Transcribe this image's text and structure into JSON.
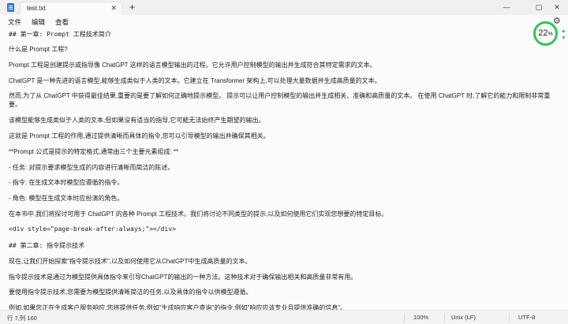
{
  "tab": {
    "title": "test.txt",
    "close": "✕",
    "new": "+"
  },
  "window": {
    "minimize": "—",
    "maximize": "▢",
    "close": "✕"
  },
  "menu": {
    "file": "文件",
    "edit": "编辑",
    "view": "查看"
  },
  "zoom": {
    "value": "22",
    "unit": "%"
  },
  "lines": [
    "## 第一章: Prompt 工程技术简介",
    "什么是 Prompt 工程?",
    "Prompt 工程是创建提示或指导像 ChatGPT 这样的语言模型输出的过程。它允许用户控制模型的输出并生成符合其特定需求的文本。",
    "ChatGPT 是一种先进的语言模型,能够生成类似于人类的文本。它建立在 Transformer 架构上,可以处理大量数据并生成高质量的文本。",
    "然而,为了从 ChatGPT 中获得最佳结果,重要的是要了解如何正确地提示模型。 提示可以让用户控制模型的输出并生成相关、准确和高质量的文本。 在使用 ChatGPT 时,了解它的能力和限制非常重",
    "要。",
    "该模型能够生成类似于人类的文本,但如果没有适当的指导,它可能无法始终产生期望的输出。",
    "这就是 Prompt 工程的作用,通过提供清晰而具体的指令,您可以引导模型的输出并确保其相关。",
    "**Prompt 公式是提示的特定格式,通常由三个主要元素组成: **",
    "- 任务: 对提示要求模型生成的内容进行清晰而简洁的陈述。",
    "- 指令: 在生成文本时模型应遵循的指令。",
    "- 角色: 模型在生成文本时应扮演的角色。",
    "在本书中,我们将探讨可用于 ChatGPT 的各种 Prompt 工程技术。我们将讨论不同类型的提示,以及如何使用它们实现您想要的特定目标。",
    "<div style=\"page-break-after:always;\"></div>",
    "## 第二章: 指令提示技术",
    "现在,让我们开始探索\"指令提示技术\",以及如何使用它从ChatGPT中生成高质量的文本。",
    "指令提示技术是通过为模型提供具体指令来引导ChatGPT的输出的一种方法。这种技术对于确保输出相关和高质量非常有用。",
    "要使用指令提示技术,您需要为模型提供清晰简洁的任务,以及具体的指令以供模型遵循。",
    "例如,如果您正在生成客户服务响应,您将提供任务,例如\"生成响应客户查询\"的指令,例如\"响应应该专业且提供准确的信息\"。"
  ],
  "status": {
    "position": "行 7,列 160",
    "zoom": "100%",
    "line_ending": "Unix (LF)",
    "encoding": "UTF-8"
  }
}
